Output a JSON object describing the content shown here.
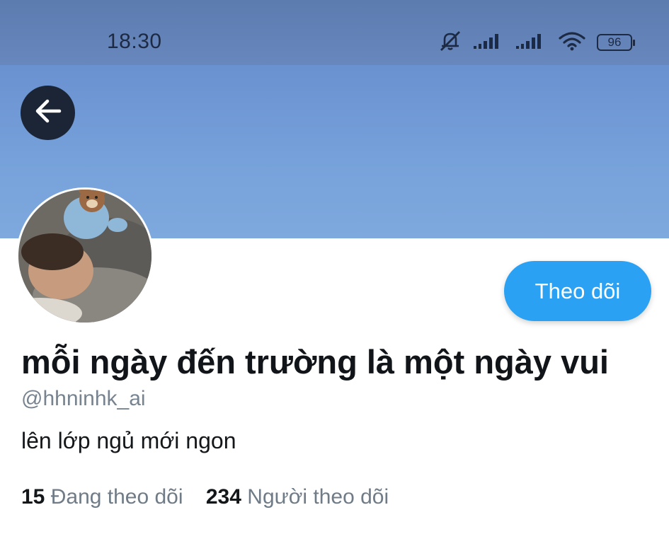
{
  "status_bar": {
    "time": "18:30",
    "battery": "96",
    "icons": [
      "bell-muted-icon",
      "signal-icon",
      "signal-icon",
      "wifi-icon",
      "battery-icon"
    ]
  },
  "header": {
    "back_icon": "arrow-left-icon"
  },
  "profile": {
    "display_name": "mỗi ngày đến trường là một ngày vui",
    "handle": "@hhninhk_ai",
    "bio": "lên lớp ngủ mới ngon",
    "follow_label": "Theo dõi",
    "following_count": "15",
    "following_label": "Đang theo dõi",
    "followers_count": "234",
    "followers_label": "Người theo dõi"
  },
  "colors": {
    "accent": "#2aa1f2",
    "banner": "#76a1da",
    "status_bar": "#6384ba"
  }
}
